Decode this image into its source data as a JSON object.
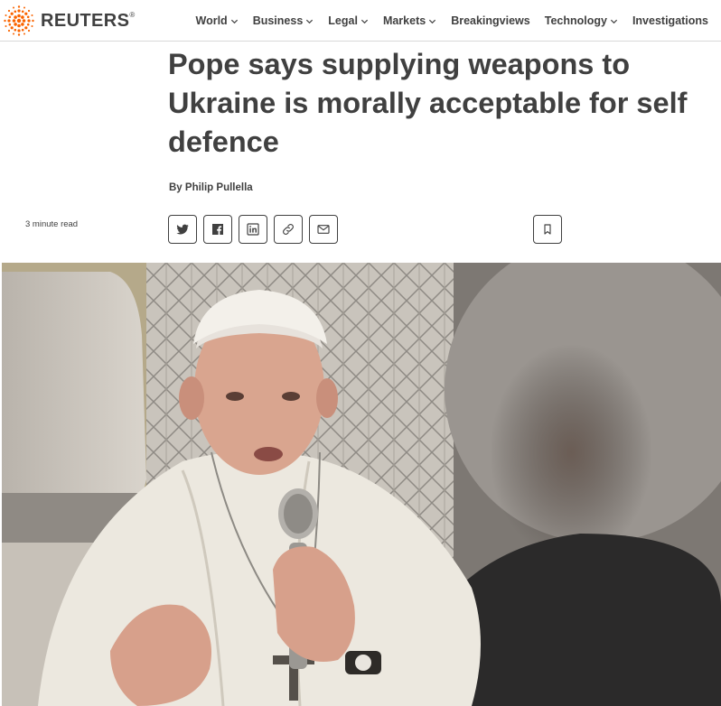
{
  "brand": {
    "name": "REUTERS",
    "registered": "®",
    "accent_color": "#fa6400"
  },
  "nav": {
    "items": [
      {
        "label": "World",
        "has_dropdown": true
      },
      {
        "label": "Business",
        "has_dropdown": true
      },
      {
        "label": "Legal",
        "has_dropdown": true
      },
      {
        "label": "Markets",
        "has_dropdown": true
      },
      {
        "label": "Breakingviews",
        "has_dropdown": false
      },
      {
        "label": "Technology",
        "has_dropdown": true
      },
      {
        "label": "Investigations",
        "has_dropdown": false
      }
    ]
  },
  "article": {
    "headline": "Pope says supplying weapons to Ukraine is morally acceptable for self defence",
    "byline_prefix": "By ",
    "author": "Philip Pullella",
    "read_time": "3 minute read"
  },
  "share": {
    "buttons": [
      "twitter-icon",
      "facebook-icon",
      "linkedin-icon",
      "link-icon",
      "email-icon"
    ],
    "bookmark": "bookmark-icon"
  },
  "photo": {
    "subject": "pope-with-microphone"
  }
}
